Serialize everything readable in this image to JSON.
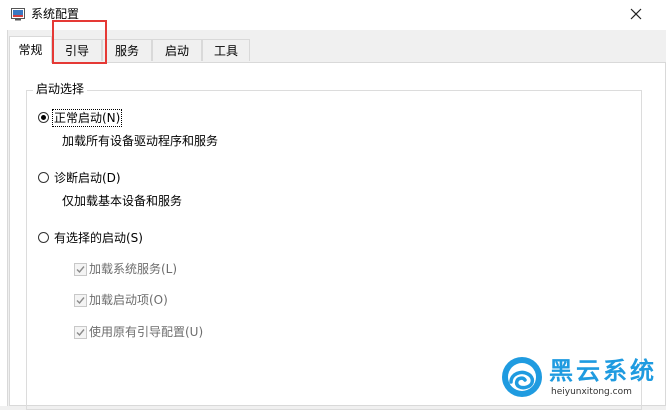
{
  "window": {
    "title": "系统配置",
    "app_icon": "msconfig-icon",
    "close_icon": "close-icon"
  },
  "tabs": [
    {
      "label": "常规",
      "active": true
    },
    {
      "label": "引导",
      "active": false,
      "highlighted": true
    },
    {
      "label": "服务",
      "active": false
    },
    {
      "label": "启动",
      "active": false
    },
    {
      "label": "工具",
      "active": false
    }
  ],
  "startup_selection": {
    "group_label": "启动选择",
    "options": [
      {
        "label": "正常启动(N)",
        "description": "加载所有设备驱动程序和服务",
        "selected": true
      },
      {
        "label": "诊断启动(D)",
        "description": "仅加载基本设备和服务",
        "selected": false
      },
      {
        "label": "有选择的启动(S)",
        "selected": false
      }
    ],
    "selective_items": [
      {
        "label": "加载系统服务(L)",
        "checked": true,
        "enabled": false
      },
      {
        "label": "加载启动项(O)",
        "checked": true,
        "enabled": false
      },
      {
        "label": "使用原有引导配置(U)",
        "checked": true,
        "enabled": false
      }
    ]
  },
  "watermark": {
    "name": "黑云系统",
    "url": "heiyunxitong.com"
  },
  "colors": {
    "highlight_box": "#e53935",
    "watermark_blue": "#1f9be0",
    "disabled_text": "#6d6d6d"
  }
}
